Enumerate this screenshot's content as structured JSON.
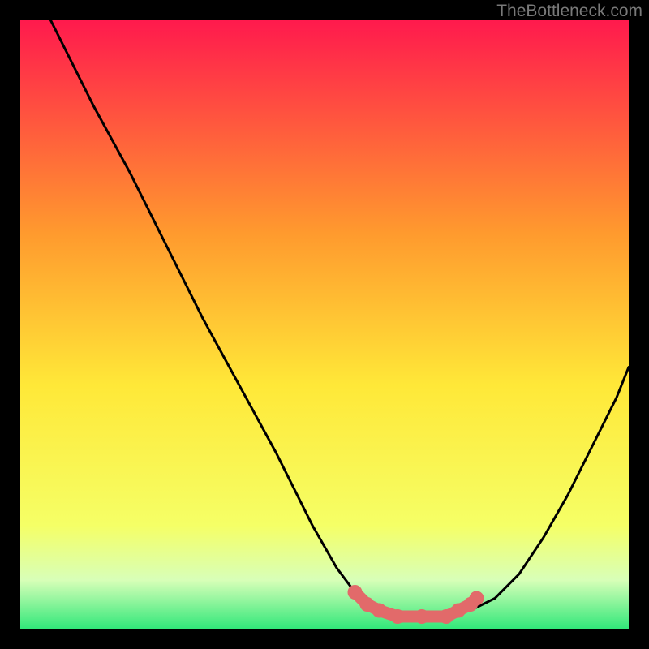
{
  "watermark": "TheBottleneck.com",
  "colors": {
    "gradient_top": "#ff1a4d",
    "gradient_upper": "#ff7a33",
    "gradient_mid": "#ffe838",
    "gradient_lower": "#f5ff66",
    "gradient_pale": "#e8ffb0",
    "gradient_bottom": "#32e87a",
    "curve": "#000000",
    "marker": "#e26a6a"
  },
  "chart_data": {
    "type": "line",
    "title": "",
    "xlabel": "",
    "ylabel": "",
    "xlim": [
      0,
      100
    ],
    "ylim": [
      0,
      100
    ],
    "series": [
      {
        "name": "bottleneck-curve",
        "x": [
          5,
          8,
          12,
          18,
          24,
          30,
          36,
          42,
          48,
          52,
          55,
          57,
          59,
          62,
          66,
          70,
          74,
          78,
          82,
          86,
          90,
          94,
          98,
          100
        ],
        "y": [
          100,
          94,
          86,
          75,
          63,
          51,
          40,
          29,
          17,
          10,
          6,
          4,
          3,
          2,
          2,
          2,
          3,
          5,
          9,
          15,
          22,
          30,
          38,
          43
        ]
      }
    ],
    "markers": {
      "name": "highlight-dots",
      "points": [
        {
          "x": 55,
          "y": 6
        },
        {
          "x": 57,
          "y": 4
        },
        {
          "x": 59,
          "y": 3
        },
        {
          "x": 62,
          "y": 2
        },
        {
          "x": 66,
          "y": 2
        },
        {
          "x": 70,
          "y": 2
        },
        {
          "x": 72,
          "y": 3
        },
        {
          "x": 74,
          "y": 4
        },
        {
          "x": 75,
          "y": 5
        }
      ]
    }
  }
}
